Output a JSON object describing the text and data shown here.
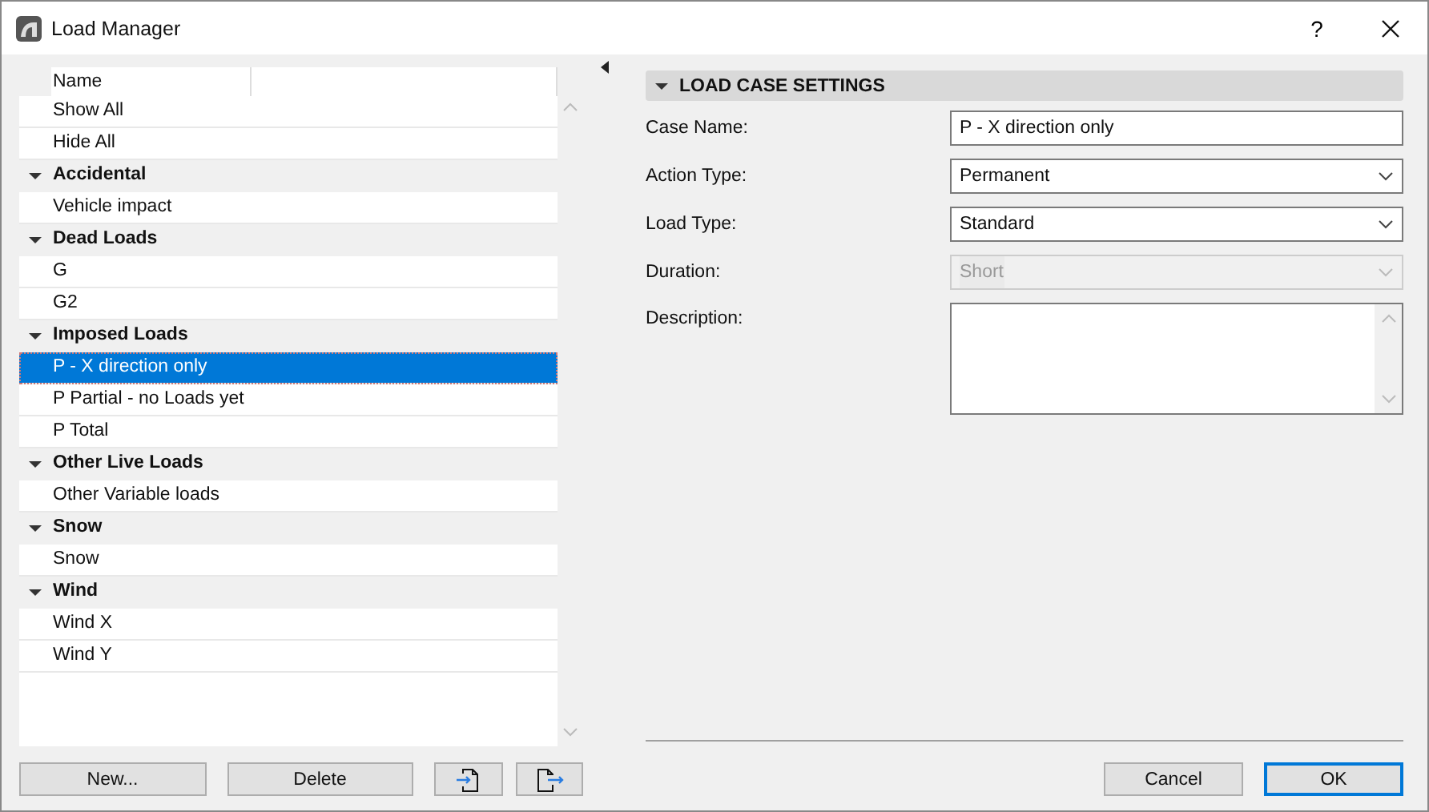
{
  "window": {
    "title": "Load Manager",
    "help": "?"
  },
  "list": {
    "column_header": "Name",
    "items": [
      {
        "label": "Show All",
        "selected": false
      },
      {
        "label": "Hide All",
        "selected": false
      }
    ],
    "groups": [
      {
        "label": "Accidental",
        "expanded": true,
        "children": [
          {
            "label": "Vehicle impact",
            "selected": false
          }
        ]
      },
      {
        "label": "Dead Loads",
        "expanded": true,
        "children": [
          {
            "label": "G",
            "selected": false
          },
          {
            "label": "G2",
            "selected": false
          }
        ]
      },
      {
        "label": "Imposed Loads",
        "expanded": true,
        "children": [
          {
            "label": "P - X direction only",
            "selected": true
          },
          {
            "label": "P Partial - no Loads yet",
            "selected": false
          },
          {
            "label": "P Total",
            "selected": false
          }
        ]
      },
      {
        "label": "Other Live Loads",
        "expanded": true,
        "children": [
          {
            "label": "Other Variable loads",
            "selected": false
          }
        ]
      },
      {
        "label": "Snow",
        "expanded": true,
        "children": [
          {
            "label": "Snow",
            "selected": false
          }
        ]
      },
      {
        "label": "Wind",
        "expanded": true,
        "children": [
          {
            "label": "Wind X",
            "selected": false
          },
          {
            "label": "Wind Y",
            "selected": false
          }
        ]
      }
    ]
  },
  "list_buttons": [
    "New...",
    "Delete"
  ],
  "settings": {
    "title": "LOAD CASE SETTINGS",
    "expanded": true,
    "fields": [
      {
        "kind": "text",
        "label": "Case Name:",
        "value": "P - X direction only",
        "disabled": false
      },
      {
        "kind": "dropdown",
        "label": "Action Type:",
        "value": "Permanent",
        "disabled": false
      },
      {
        "kind": "dropdown",
        "label": "Load Type:",
        "value": "Standard",
        "disabled": false
      },
      {
        "kind": "dropdown",
        "label": "Duration:",
        "value": "Short",
        "disabled": true
      },
      {
        "kind": "textarea",
        "label": "Description:",
        "disabled": false
      }
    ]
  },
  "buttons": [
    {
      "label": "Cancel",
      "default": false
    },
    {
      "label": "OK",
      "default": true
    }
  ]
}
